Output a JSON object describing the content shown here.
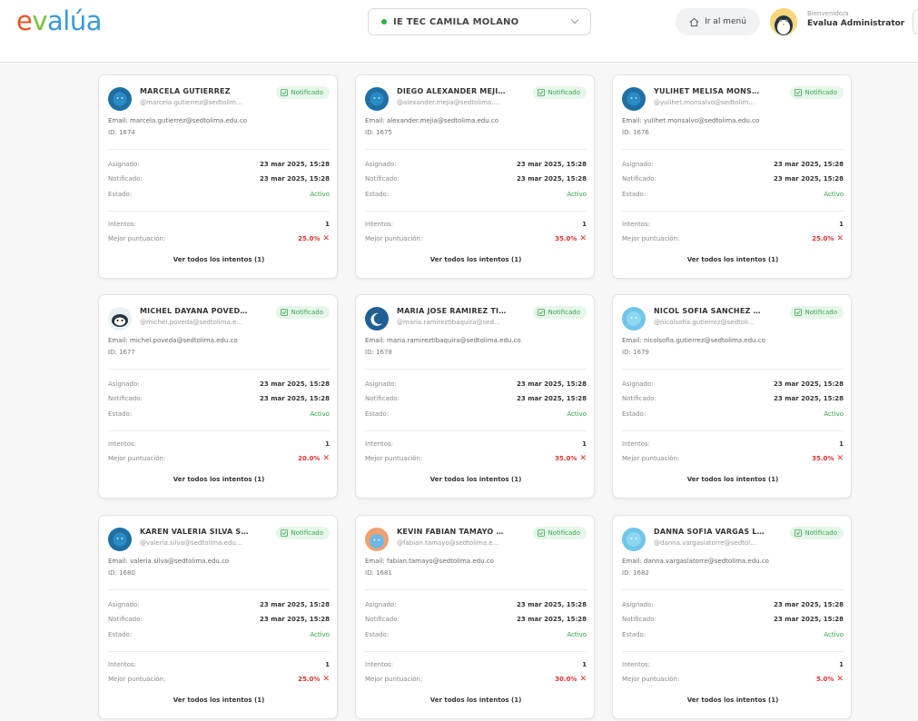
{
  "app": {
    "logo": {
      "part1": "e",
      "part2": "v",
      "part3": "alúa"
    },
    "institution": "IE TEC CAMILA MOLANO",
    "menu_button": "Ir al menú",
    "greeting": "Bienvenido/a",
    "user_name": "Evalua Administrator"
  },
  "labels": {
    "email_prefix": "Email:",
    "id_prefix": "ID:",
    "assigned": "Asignado:",
    "notified": "Notificado:",
    "status": "Estado:",
    "attempts": "Intentos:",
    "best_score": "Mejor puntuación:",
    "badge": "Notificado",
    "view_attempts": "Ver todos los intentos (1)"
  },
  "colors": {
    "accent_green": "#2f9e4a",
    "score_red": "#e03030",
    "avatar_blue": "#1f6fa3",
    "avatar_light": "#6fc6e8"
  },
  "students": [
    {
      "name": "MARCELA GUTIERREZ",
      "username": "@marcela.gutierrez@sedtolima...",
      "email": "marcela.gutierrez@sedtolima.edu.co",
      "id": "1674",
      "assigned": "23 mar 2025, 15:28",
      "notified": "23 mar 2025, 15:28",
      "status": "Activo",
      "attempts": "1",
      "score": "25.0%",
      "avatar": "dark"
    },
    {
      "name": "DIEGO ALEXANDER MEJIA UR...",
      "username": "@alexander.mejia@sedtolima.e...",
      "email": "alexander.mejia@sedtolima.edu.co",
      "id": "1675",
      "assigned": "23 mar 2025, 15:28",
      "notified": "23 mar 2025, 15:28",
      "status": "Activo",
      "attempts": "1",
      "score": "35.0%",
      "avatar": "dark"
    },
    {
      "name": "YULIHET MELISA MONSALVO ...",
      "username": "@yulihet.monsalvo@sedtolima...",
      "email": "yulihet.monsalvo@sedtolima.edu.co",
      "id": "1676",
      "assigned": "23 mar 2025, 15:28",
      "notified": "23 mar 2025, 15:28",
      "status": "Activo",
      "attempts": "1",
      "score": "25.0%",
      "avatar": "dark"
    },
    {
      "name": "MICHEL DAYANA POVEDA T...",
      "username": "@michel.poveda@sedtolima.ed...",
      "email": "michel.poveda@sedtolima.edu.co",
      "id": "1677",
      "assigned": "23 mar 2025, 15:28",
      "notified": "23 mar 2025, 15:28",
      "status": "Activo",
      "attempts": "1",
      "score": "20.0%",
      "avatar": "penguin"
    },
    {
      "name": "MARIA JOSE RAMIREZ TIBAQUIRA",
      "username": "@maria.ramireztibaquira@sedtoli...",
      "email": "maria.ramireztibaquira@sedtolima.edu.co",
      "id": "1678",
      "assigned": "23 mar 2025, 15:28",
      "notified": "23 mar 2025, 15:28",
      "status": "Activo",
      "attempts": "1",
      "score": "35.0%",
      "avatar": "moon"
    },
    {
      "name": "NICOL SOFIA SANCHEZ GUTI...",
      "username": "@nicolsofia.gutierrez@sedtolim...",
      "email": "nicolsofia.gutierrez@sedtolima.edu.co",
      "id": "1679",
      "assigned": "23 mar 2025, 15:28",
      "notified": "23 mar 2025, 15:28",
      "status": "Activo",
      "attempts": "1",
      "score": "35.0%",
      "avatar": "light"
    },
    {
      "name": "KAREN VALERIA SILVA SANC...",
      "username": "@valeria.silva@sedtolima.edu.co",
      "email": "valeria.silva@sedtolima.edu.co",
      "id": "1680",
      "assigned": "23 mar 2025, 15:28",
      "notified": "23 mar 2025, 15:28",
      "status": "Activo",
      "attempts": "1",
      "score": "25.0%",
      "avatar": "dark"
    },
    {
      "name": "KEVIN FABIAN TAMAYO RIVE...",
      "username": "@fabian.tamayo@sedtolima.ed...",
      "email": "fabian.tamayo@sedtolima.edu.co",
      "id": "1681",
      "assigned": "23 mar 2025, 15:28",
      "notified": "23 mar 2025, 15:28",
      "status": "Activo",
      "attempts": "1",
      "score": "30.0%",
      "avatar": "orange"
    },
    {
      "name": "DANNA SOFIA VARGAS LA TO...",
      "username": "@danna.vargaslatorre@sedtolim...",
      "email": "danna.vargaslatorre@sedtolima.edu.co",
      "id": "1682",
      "assigned": "23 mar 2025, 15:28",
      "notified": "23 mar 2025, 15:28",
      "status": "Activo",
      "attempts": "1",
      "score": "5.0%",
      "avatar": "light"
    }
  ]
}
